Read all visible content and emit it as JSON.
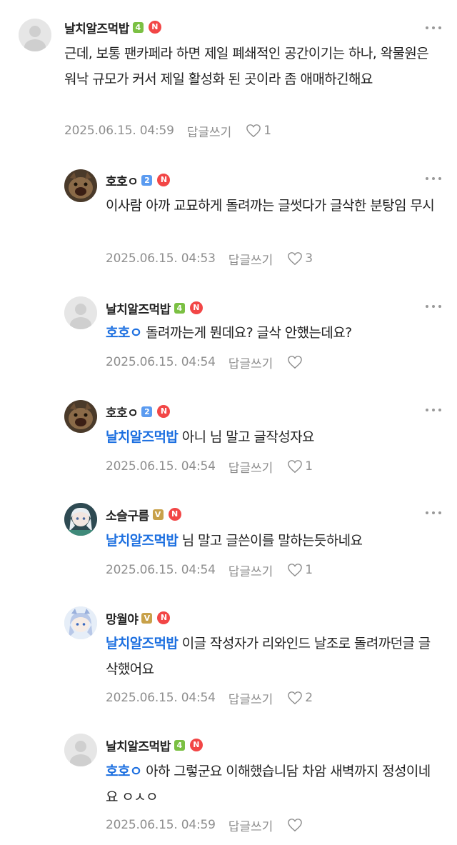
{
  "comments": [
    {
      "nick": "날치알즈먹밥",
      "level": "4",
      "level_color": "green",
      "badge": "N",
      "mention": "",
      "text": "근데, 보통 팬카페라 하면 제일 폐쇄적인 공간이기는 하나, 왁물원은 워낙 규모가 커서 제일 활성화 된 곳이라 좀 애매하긴해요",
      "date": "2025.06.15. 04:59",
      "reply_label": "답글쓰기",
      "likes": "1",
      "avatar": "default"
    },
    {
      "nick": "호호ㅇ",
      "level": "2",
      "level_color": "blue",
      "badge": "N",
      "mention": "",
      "text": "이사람 아까 교묘하게 돌려까는 글썻다가 글삭한 분탕임 무시",
      "date": "2025.06.15. 04:53",
      "reply_label": "답글쓰기",
      "likes": "3",
      "avatar": "cat"
    },
    {
      "nick": "날치알즈먹밥",
      "level": "4",
      "level_color": "green",
      "badge": "N",
      "mention": "호호ㅇ",
      "text": "돌려까는게 뭔데요? 글삭 안했는데요?",
      "date": "2025.06.15. 04:54",
      "reply_label": "답글쓰기",
      "likes": "",
      "avatar": "default"
    },
    {
      "nick": "호호ㅇ",
      "level": "2",
      "level_color": "blue",
      "badge": "N",
      "mention": "날치알즈먹밥",
      "text": "아니 님 말고 글작성자요",
      "date": "2025.06.15. 04:54",
      "reply_label": "답글쓰기",
      "likes": "1",
      "avatar": "cat"
    },
    {
      "nick": "소슬구름",
      "level": "V",
      "level_color": "gold",
      "badge": "N",
      "mention": "날치알즈먹밥",
      "text": "님 말고 글쓴이를 말하는듯하네요",
      "date": "2025.06.15. 04:54",
      "reply_label": "답글쓰기",
      "likes": "1",
      "avatar": "anime1"
    },
    {
      "nick": "망월야",
      "level": "V",
      "level_color": "gold",
      "badge": "N",
      "mention": "날치알즈먹밥",
      "text": "이글 작성자가 리와인드 날조로 돌려까던글 글삭했어요",
      "date": "2025.06.15. 04:54",
      "reply_label": "답글쓰기",
      "likes": "2",
      "avatar": "anime2"
    },
    {
      "nick": "날치알즈먹밥",
      "level": "4",
      "level_color": "green",
      "badge": "N",
      "mention": "호호ㅇ",
      "text": "아하 그렇군요 이해했습니담 차암 새벽까지 정성이네요 ㅇㅅㅇ",
      "date": "2025.06.15. 04:59",
      "reply_label": "답글쓰기",
      "likes": "",
      "avatar": "default"
    }
  ]
}
